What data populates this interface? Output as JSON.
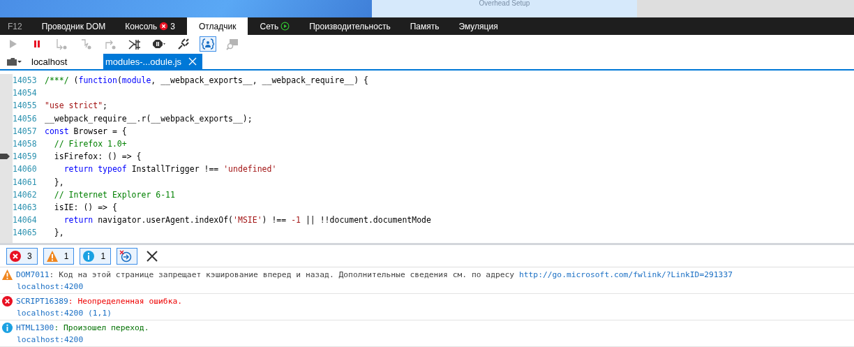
{
  "page_behind": {
    "caption": "Overhead Setup"
  },
  "tabs": [
    {
      "label": "F12",
      "kind": "label",
      "selected": false
    },
    {
      "label": "Проводник DOM",
      "kind": "plain",
      "selected": false
    },
    {
      "label": "Консоль",
      "kind": "errors",
      "count": "3",
      "selected": false
    },
    {
      "label": "Отладчик",
      "kind": "plain",
      "selected": true
    },
    {
      "label": "Сеть",
      "kind": "recording",
      "selected": false
    },
    {
      "label": "Производительность",
      "kind": "plain",
      "selected": false
    },
    {
      "label": "Память",
      "kind": "plain",
      "selected": false
    },
    {
      "label": "Эмуляция",
      "kind": "plain",
      "selected": false
    }
  ],
  "debug_toolbar": [
    {
      "kind": "continue",
      "disabled": true,
      "selected": false
    },
    {
      "kind": "pause",
      "disabled": false,
      "selected": false
    },
    {
      "kind": "step-into",
      "disabled": true,
      "selected": false
    },
    {
      "kind": "step-over",
      "disabled": true,
      "selected": false
    },
    {
      "kind": "step-out",
      "disabled": true,
      "selected": false
    },
    {
      "kind": "break-worker",
      "disabled": false,
      "selected": false
    },
    {
      "kind": "exceptions",
      "disabled": false,
      "selected": false
    },
    {
      "kind": "disconnect",
      "disabled": false,
      "selected": false
    },
    {
      "kind": "pretty-print",
      "disabled": false,
      "selected": true
    },
    {
      "kind": "search-map",
      "disabled": true,
      "selected": false
    }
  ],
  "file_bar": {
    "host": "localhost",
    "open_file": {
      "label": "modules-...odule.js",
      "selected": true
    }
  },
  "code": {
    "lines": [
      {
        "number": "14053",
        "current": false,
        "tokens": [
          {
            "text": "/***/",
            "kind": "comment"
          },
          {
            "text": " (",
            "kind": "plain"
          },
          {
            "text": "function",
            "kind": "keyword"
          },
          {
            "text": "(",
            "kind": "plain"
          },
          {
            "text": "module",
            "kind": "keyword"
          },
          {
            "text": ", __webpack_exports__, __webpack_require__) {",
            "kind": "plain"
          }
        ]
      },
      {
        "number": "14054",
        "current": false
      },
      {
        "number": "14055",
        "current": false,
        "tokens": [
          {
            "text": "\"use strict\"",
            "kind": "string"
          },
          {
            "text": ";",
            "kind": "plain"
          }
        ]
      },
      {
        "number": "14056",
        "current": false,
        "tokens": [
          {
            "text": "__webpack_require__.r(__webpack_exports__);",
            "kind": "plain"
          }
        ]
      },
      {
        "number": "14057",
        "current": false,
        "tokens": [
          {
            "text": "const",
            "kind": "keyword"
          },
          {
            "text": " Browser = {",
            "kind": "plain"
          }
        ]
      },
      {
        "number": "14058",
        "current": false,
        "tokens": [
          {
            "text": "  // Firefox 1.0+",
            "kind": "comment"
          }
        ]
      },
      {
        "number": "14059",
        "current": true,
        "tokens": [
          {
            "text": "  isFirefox: () => {",
            "kind": "plain"
          }
        ]
      },
      {
        "number": "14060",
        "current": false,
        "tokens": [
          {
            "text": "    return typeof",
            "kind": "keyword"
          },
          {
            "text": " InstallTrigger !== ",
            "kind": "plain"
          },
          {
            "text": "'undefined'",
            "kind": "string"
          }
        ]
      },
      {
        "number": "14061",
        "current": false,
        "tokens": [
          {
            "text": "  },",
            "kind": "plain"
          }
        ]
      },
      {
        "number": "14062",
        "current": false,
        "tokens": [
          {
            "text": "  // Internet Explorer 6-11",
            "kind": "comment"
          }
        ]
      },
      {
        "number": "14063",
        "current": false,
        "tokens": [
          {
            "text": "  isIE: () => {",
            "kind": "plain"
          }
        ]
      },
      {
        "number": "14064",
        "current": false,
        "tokens": [
          {
            "text": "    return",
            "kind": "keyword"
          },
          {
            "text": " navigator.userAgent.indexOf(",
            "kind": "plain"
          },
          {
            "text": "'MSIE'",
            "kind": "string"
          },
          {
            "text": ") !== ",
            "kind": "plain"
          },
          {
            "text": "-1",
            "kind": "string"
          },
          {
            "text": " || !!document.documentMode",
            "kind": "plain"
          }
        ]
      },
      {
        "number": "14065",
        "current": false,
        "tokens": [
          {
            "text": "  },",
            "kind": "plain"
          }
        ]
      }
    ]
  },
  "console_filters": [
    {
      "kind": "error",
      "count": "3",
      "selected": true
    },
    {
      "kind": "warning",
      "count": "1",
      "selected": true
    },
    {
      "kind": "info",
      "count": "1",
      "selected": true
    },
    {
      "kind": "clear-on-navigate",
      "selected": true
    },
    {
      "kind": "clear"
    }
  ],
  "messages": [
    {
      "kind": "warning",
      "code": "DOM7011",
      "text": ": Код на этой странице запрещает кэширование вперед и назад. Дополнительные сведения см. по адресу ",
      "link": "http://go.microsoft.com/fwlink/?LinkID=291337",
      "source": "localhost:4200"
    },
    {
      "kind": "error",
      "code": "SCRIPT16389",
      "text": ": Неопределенная ошибка.",
      "source": "localhost:4200 (1,1)"
    },
    {
      "kind": "info",
      "code": "HTML1300",
      "text": ": Произошел переход.",
      "source": "localhost:4200"
    }
  ]
}
